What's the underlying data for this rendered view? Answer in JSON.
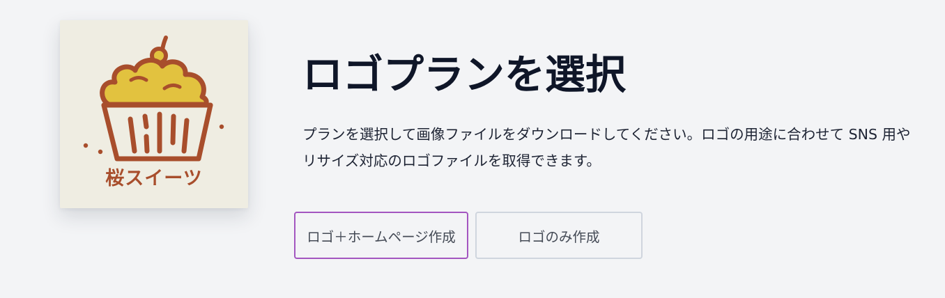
{
  "logo": {
    "text": "桜スイーツ",
    "icon": "cupcake-icon",
    "colors": {
      "background": "#efede2",
      "outline": "#a84e2c",
      "cream": "#e2c23f"
    }
  },
  "header": {
    "title": "ロゴプランを選択",
    "description": "プランを選択して画像ファイルをダウンロードしてください。ロゴの用途に合わせて SNS 用やリサイズ対応のロゴファイルを取得できます。"
  },
  "plans": {
    "logo_homepage_label": "ロゴ＋ホームページ作成",
    "logo_only_label": "ロゴのみ作成"
  },
  "colors": {
    "selected_border": "#a356c0",
    "default_border": "#cfd5de",
    "title": "#0f1628"
  }
}
